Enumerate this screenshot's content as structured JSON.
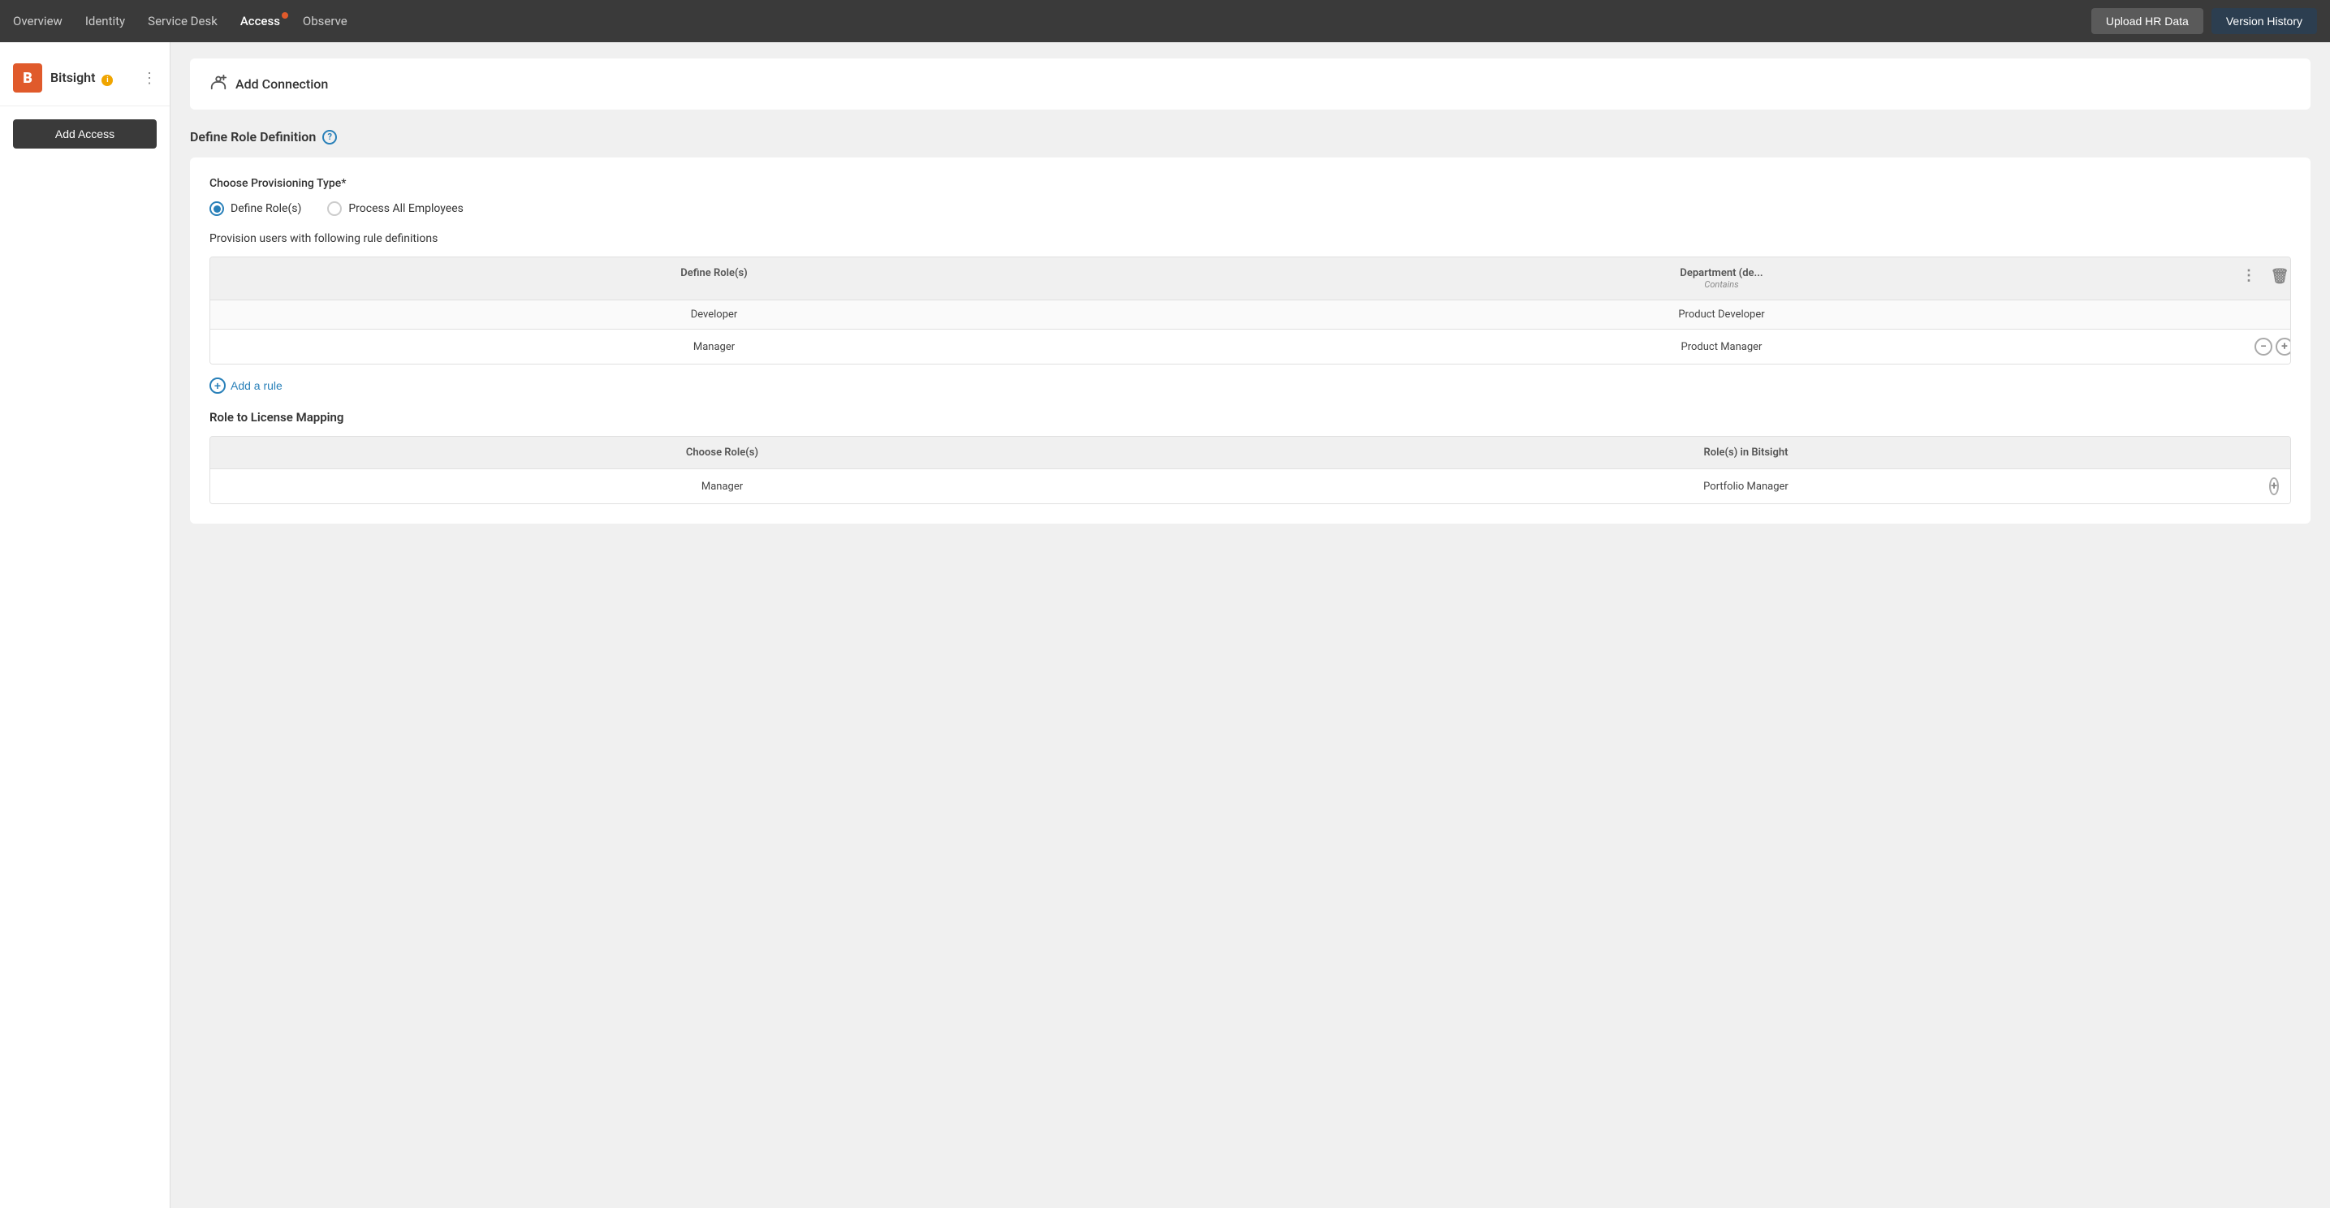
{
  "nav": {
    "items": [
      {
        "label": "Overview",
        "active": false
      },
      {
        "label": "Identity",
        "active": false
      },
      {
        "label": "Service Desk",
        "active": false
      },
      {
        "label": "Access",
        "active": true,
        "badge": true
      },
      {
        "label": "Observe",
        "active": false
      }
    ],
    "upload_hr_label": "Upload HR Data",
    "version_history_label": "Version History"
  },
  "sidebar": {
    "brand_letter": "B",
    "brand_name": "Bitsight",
    "add_access_label": "Add Access"
  },
  "add_connection": {
    "icon": "➕",
    "label": "Add Connection"
  },
  "role_definition": {
    "section_title": "Define Role Definition",
    "provisioning_type_label": "Choose Provisioning Type*",
    "radio_options": [
      {
        "label": "Define Role(s)",
        "selected": true
      },
      {
        "label": "Process All Employees",
        "selected": false
      }
    ],
    "provision_users_text": "Provision users with following rule definitions",
    "rule_table": {
      "col1_header": "Define Role(s)",
      "col2_header": "Department (de...",
      "col2_sub": "Contains",
      "rows": [
        {
          "col1": "Developer",
          "col2": "Product Developer"
        },
        {
          "col1": "Manager",
          "col2": "Product Manager"
        }
      ]
    },
    "add_rule_label": "Add a rule",
    "role_license_label": "Role to License Mapping",
    "license_table": {
      "col1_header": "Choose Role(s)",
      "col2_header": "Role(s) in Bitsight",
      "rows": [
        {
          "col1": "Manager",
          "col2": "Portfolio Manager"
        }
      ]
    }
  }
}
